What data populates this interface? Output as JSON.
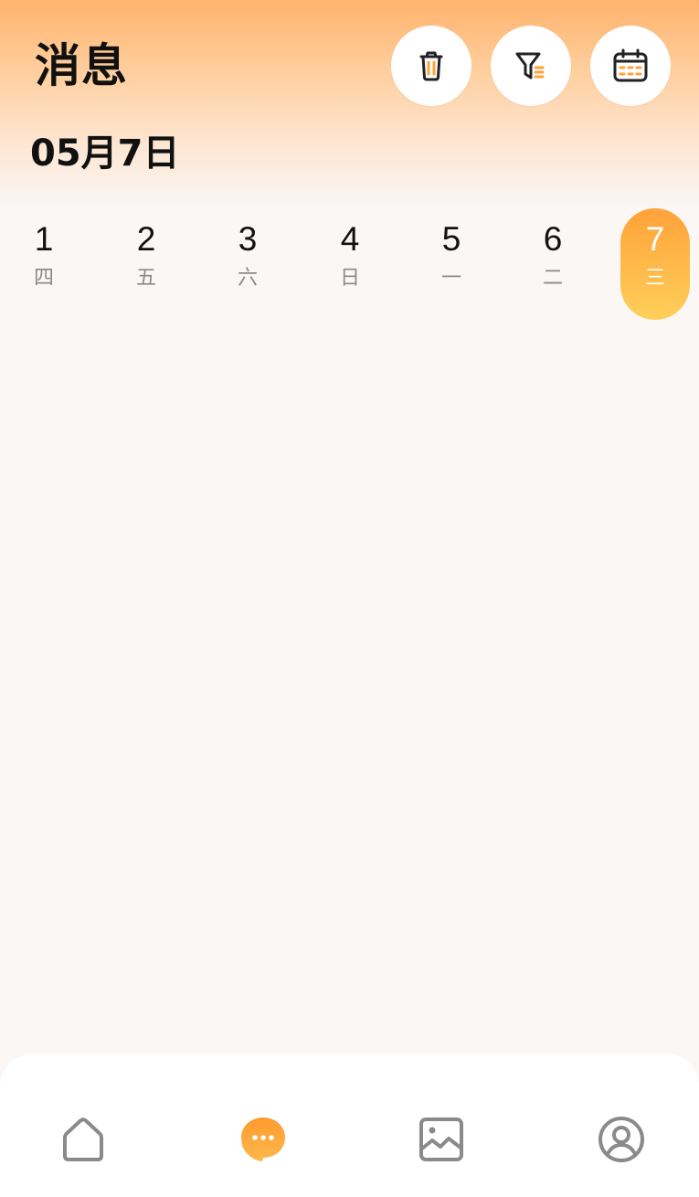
{
  "header": {
    "title": "消息",
    "actions": [
      {
        "name": "delete",
        "icon": "trash-icon"
      },
      {
        "name": "filter",
        "icon": "filter-icon"
      },
      {
        "name": "calendar",
        "icon": "calendar-icon"
      }
    ]
  },
  "date": {
    "current": "05月7日"
  },
  "days": [
    {
      "num": "1",
      "weekday": "四"
    },
    {
      "num": "2",
      "weekday": "五"
    },
    {
      "num": "3",
      "weekday": "六"
    },
    {
      "num": "4",
      "weekday": "日"
    },
    {
      "num": "5",
      "weekday": "一"
    },
    {
      "num": "6",
      "weekday": "二"
    },
    {
      "num": "7",
      "weekday": "三",
      "selected": true
    }
  ],
  "bottom_nav": {
    "items": [
      {
        "icon": "home-icon"
      },
      {
        "icon": "chat-bubble-icon",
        "active": true
      },
      {
        "icon": "image-icon"
      },
      {
        "icon": "user-icon"
      }
    ]
  },
  "colors": {
    "accent": "#FFA23A",
    "accent_light": "#FFCF5A",
    "header_top": "#FFB36D",
    "background": "#FAF7F5",
    "icon_dark": "#222222",
    "nav_icon": "#8A8A8A"
  }
}
